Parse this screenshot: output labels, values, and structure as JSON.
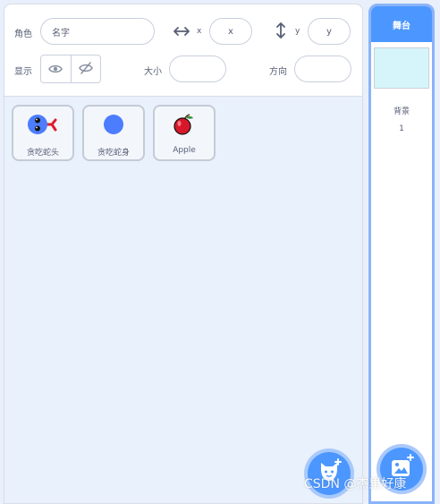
{
  "sprite_info": {
    "sprite_label": "角色",
    "name_value": "名字",
    "x_label": "x",
    "x_value": "x",
    "y_label": "y",
    "y_value": "y",
    "show_label": "显示",
    "size_label": "大小",
    "size_value": "",
    "direction_label": "方向",
    "direction_value": ""
  },
  "sprites": [
    {
      "name": "贪吃蛇头",
      "icon": "snake-head-icon"
    },
    {
      "name": "贪吃蛇身",
      "icon": "snake-body-icon"
    },
    {
      "name": "Apple",
      "icon": "apple-icon"
    }
  ],
  "stage": {
    "header": "舞台",
    "backdrops_label": "背景",
    "backdrops_count": "1"
  },
  "watermark": "CSDN @杰里好康",
  "colors": {
    "accent": "#4c97ff",
    "pane_bg": "#e9f1fc",
    "snake_blue": "#4c7dff",
    "tongue_red": "#e11d2b",
    "apple_red": "#d7182a",
    "stage_preview": "#d6f5fb"
  }
}
